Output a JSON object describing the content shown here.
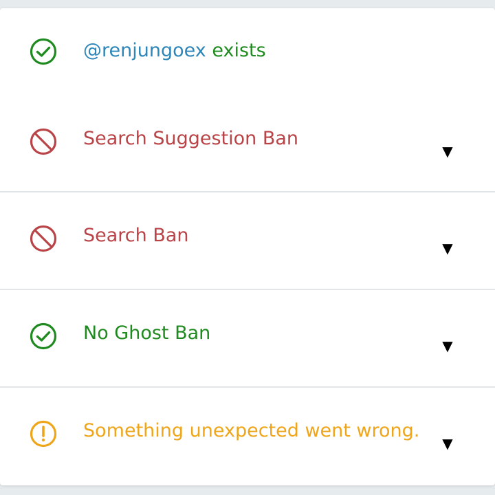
{
  "colors": {
    "success": "#1f8a1f",
    "danger": "#b94448",
    "warning": "#efa519",
    "handle": "#2e86b8"
  },
  "account": {
    "handle": "@renjungoex",
    "status_word": "exists",
    "icon": "check-circle-icon"
  },
  "checks": [
    {
      "label": "Search Suggestion Ban",
      "status": "danger",
      "icon": "ban-icon"
    },
    {
      "label": "Search Ban",
      "status": "danger",
      "icon": "ban-icon"
    },
    {
      "label": "No Ghost Ban",
      "status": "success",
      "icon": "check-circle-icon"
    },
    {
      "label": "Something unexpected went wrong.",
      "status": "warning",
      "icon": "warning-circle-icon"
    }
  ],
  "expand_glyph": "▼"
}
